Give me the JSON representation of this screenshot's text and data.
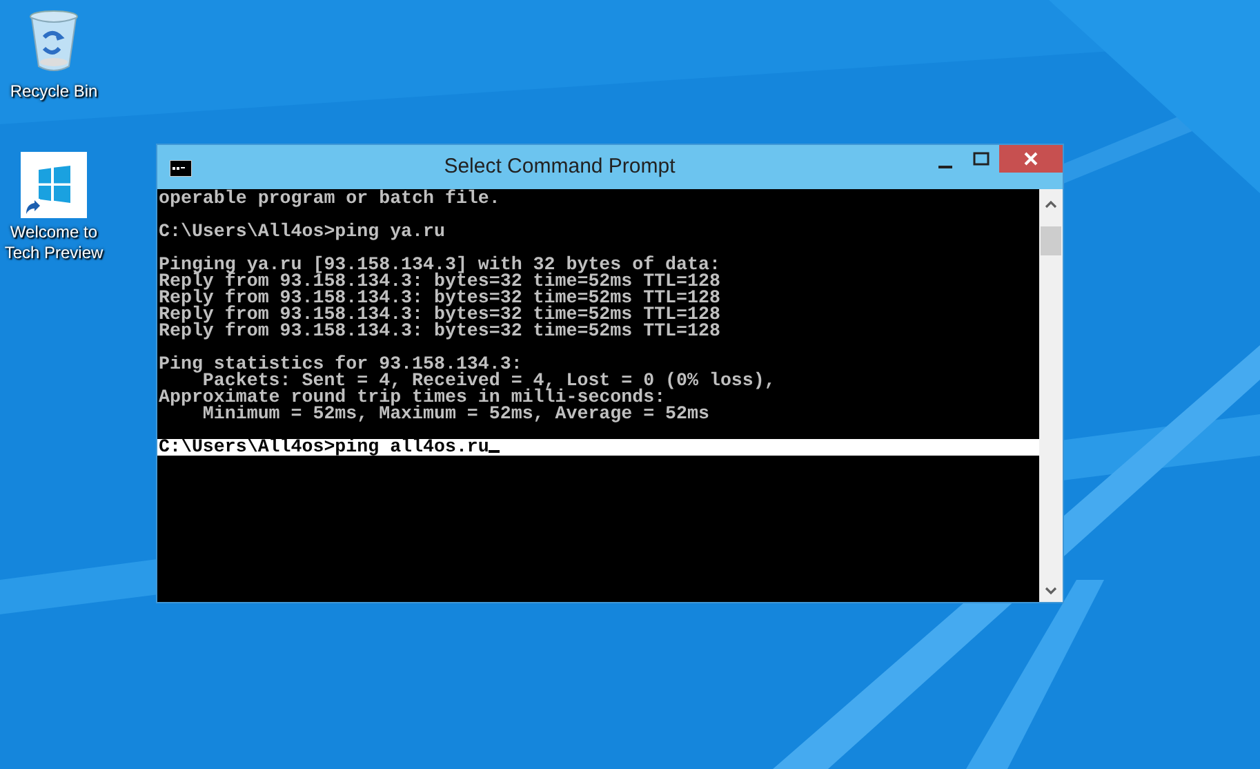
{
  "desktop_icons": [
    {
      "label": "Recycle Bin",
      "kind": "recycle-bin"
    },
    {
      "label": "Welcome to Tech Preview",
      "kind": "shortcut"
    }
  ],
  "window": {
    "title": "Select Command Prompt",
    "console_lines": [
      {
        "kind": "text",
        "text": "operable program or batch file.",
        "selected": false
      },
      {
        "kind": "blank"
      },
      {
        "kind": "text",
        "text": "C:\\Users\\All4os>ping ya.ru",
        "selected": false
      },
      {
        "kind": "blank"
      },
      {
        "kind": "text",
        "text": "Pinging ya.ru [93.158.134.3] with 32 bytes of data:",
        "selected": false
      },
      {
        "kind": "text",
        "text": "Reply from 93.158.134.3: bytes=32 time=52ms TTL=128",
        "selected": false
      },
      {
        "kind": "text",
        "text": "Reply from 93.158.134.3: bytes=32 time=52ms TTL=128",
        "selected": false
      },
      {
        "kind": "text",
        "text": "Reply from 93.158.134.3: bytes=32 time=52ms TTL=128",
        "selected": false
      },
      {
        "kind": "text",
        "text": "Reply from 93.158.134.3: bytes=32 time=52ms TTL=128",
        "selected": false
      },
      {
        "kind": "blank"
      },
      {
        "kind": "text",
        "text": "Ping statistics for 93.158.134.3:",
        "selected": false
      },
      {
        "kind": "text",
        "text": "    Packets: Sent = 4, Received = 4, Lost = 0 (0% loss),",
        "selected": false
      },
      {
        "kind": "text",
        "text": "Approximate round trip times in milli-seconds:",
        "selected": false
      },
      {
        "kind": "text",
        "text": "    Minimum = 52ms, Maximum = 52ms, Average = 52ms",
        "selected": false
      },
      {
        "kind": "blank"
      },
      {
        "kind": "text",
        "text": "C:\\Users\\All4os>ping all4os.ru",
        "selected": true,
        "cursor": true
      }
    ]
  }
}
